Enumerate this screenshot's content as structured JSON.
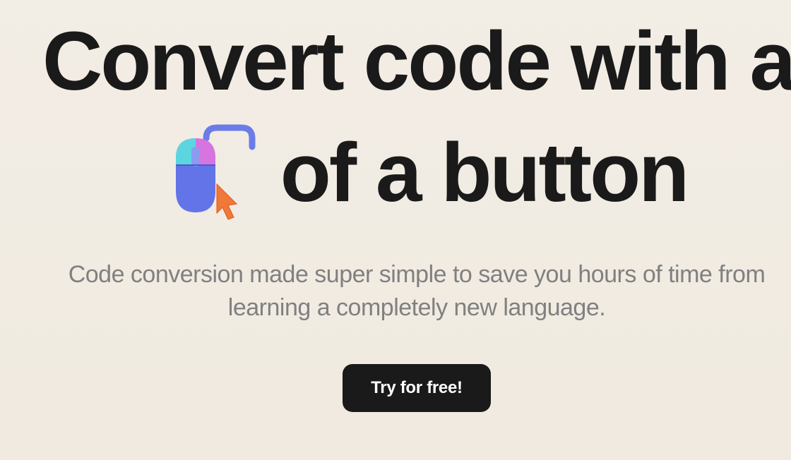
{
  "hero": {
    "title_line1": "Convert code with a click",
    "title_line2": "of a button",
    "subtitle": "Code conversion made super simple to save you hours of time from learning a completely new language.",
    "cta_label": "Try for free!"
  },
  "icons": {
    "mouse_click": "mouse-click-icon"
  }
}
